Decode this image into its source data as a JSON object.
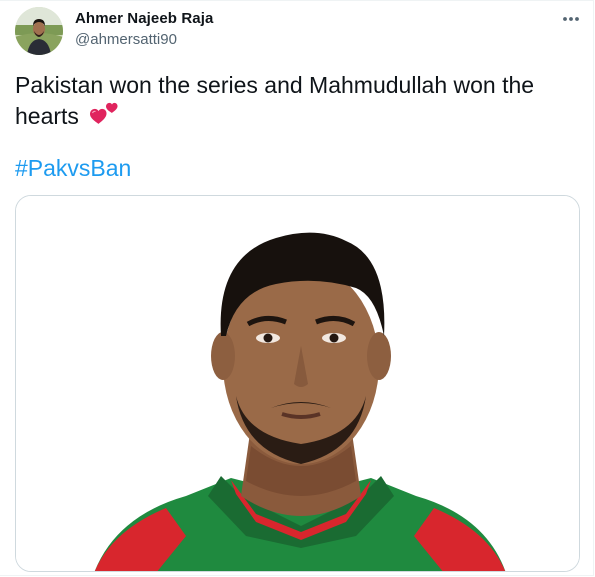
{
  "tweet": {
    "author_name": "Ahmer Najeeb Raja",
    "author_handle": "@ahmersatti90",
    "text": "Pakistan won the series and Mahmudullah won the hearts",
    "emoji": "two-hearts-icon",
    "hashtag": "#PakvsBan",
    "media_description_icon": "player-portrait-photo"
  },
  "colors": {
    "text": "#0f1419",
    "secondary": "#536471",
    "link": "#1d9bf0",
    "heart": "#e0245e",
    "border": "#cfd9de"
  }
}
